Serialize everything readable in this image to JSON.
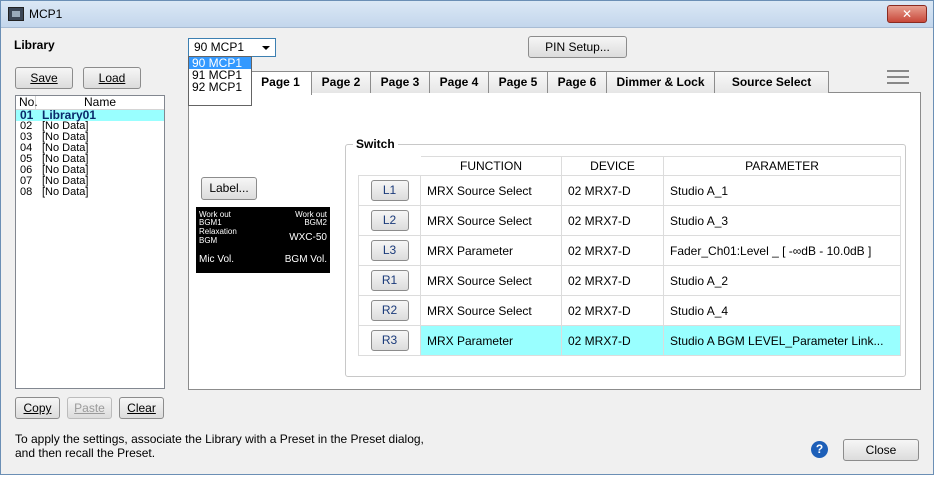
{
  "window": {
    "title": "MCP1",
    "close_glyph": "✕"
  },
  "library": {
    "heading": "Library",
    "save_label": "Save",
    "load_label": "Load",
    "columns": [
      "No.",
      "Name"
    ],
    "rows": [
      {
        "no": "01",
        "name": "Library01"
      },
      {
        "no": "02",
        "name": "[No Data]"
      },
      {
        "no": "03",
        "name": "[No Data]"
      },
      {
        "no": "04",
        "name": "[No Data]"
      },
      {
        "no": "05",
        "name": "[No Data]"
      },
      {
        "no": "06",
        "name": "[No Data]"
      },
      {
        "no": "07",
        "name": "[No Data]"
      },
      {
        "no": "08",
        "name": "[No Data]"
      }
    ],
    "copy_label": "Copy",
    "paste_label": "Paste",
    "clear_label": "Clear"
  },
  "device_select": {
    "value": "90 MCP1",
    "options": [
      "90 MCP1",
      "91 MCP1",
      "92 MCP1"
    ]
  },
  "pin_setup_label": "PIN Setup...",
  "tabs": [
    "Page 1",
    "Page 2",
    "Page 3",
    "Page 4",
    "Page 5",
    "Page 6",
    "Dimmer & Lock",
    "Source Select"
  ],
  "label_button": "Label...",
  "lcd": {
    "top_left": "Work out",
    "top_right": "Work out",
    "l2": "BGM1",
    "r2": "BGM2",
    "l3": "Relaxation",
    "l4": "BGM",
    "r3": "WXC-50",
    "l5": "Mic Vol.",
    "r5": "BGM Vol."
  },
  "switch": {
    "title": "Switch",
    "headers": [
      "FUNCTION",
      "DEVICE",
      "PARAMETER"
    ],
    "rows": [
      {
        "key": "L1",
        "function": "MRX Source Select",
        "device": "02 MRX7-D",
        "parameter": "Studio A_1"
      },
      {
        "key": "L2",
        "function": "MRX Source Select",
        "device": "02 MRX7-D",
        "parameter": "Studio A_3"
      },
      {
        "key": "L3",
        "function": "MRX Parameter",
        "device": "02 MRX7-D",
        "parameter": "Fader_Ch01:Level _ [ -∞dB - 10.0dB ]"
      },
      {
        "key": "R1",
        "function": "MRX Source Select",
        "device": "02 MRX7-D",
        "parameter": "Studio A_2"
      },
      {
        "key": "R2",
        "function": "MRX Source Select",
        "device": "02 MRX7-D",
        "parameter": "Studio A_4"
      },
      {
        "key": "R3",
        "function": "MRX Parameter",
        "device": "02 MRX7-D",
        "parameter": "Studio A BGM LEVEL_Parameter Link..."
      }
    ]
  },
  "status_text_1": "To apply the settings, associate the Library with a Preset in the Preset dialog,",
  "status_text_2": "and then recall the Preset.",
  "help_glyph": "?",
  "close_label": "Close",
  "colors": {
    "selection": "#99ffff",
    "dropdown_highlight": "#3399ff",
    "close_red": "#c8483a"
  }
}
